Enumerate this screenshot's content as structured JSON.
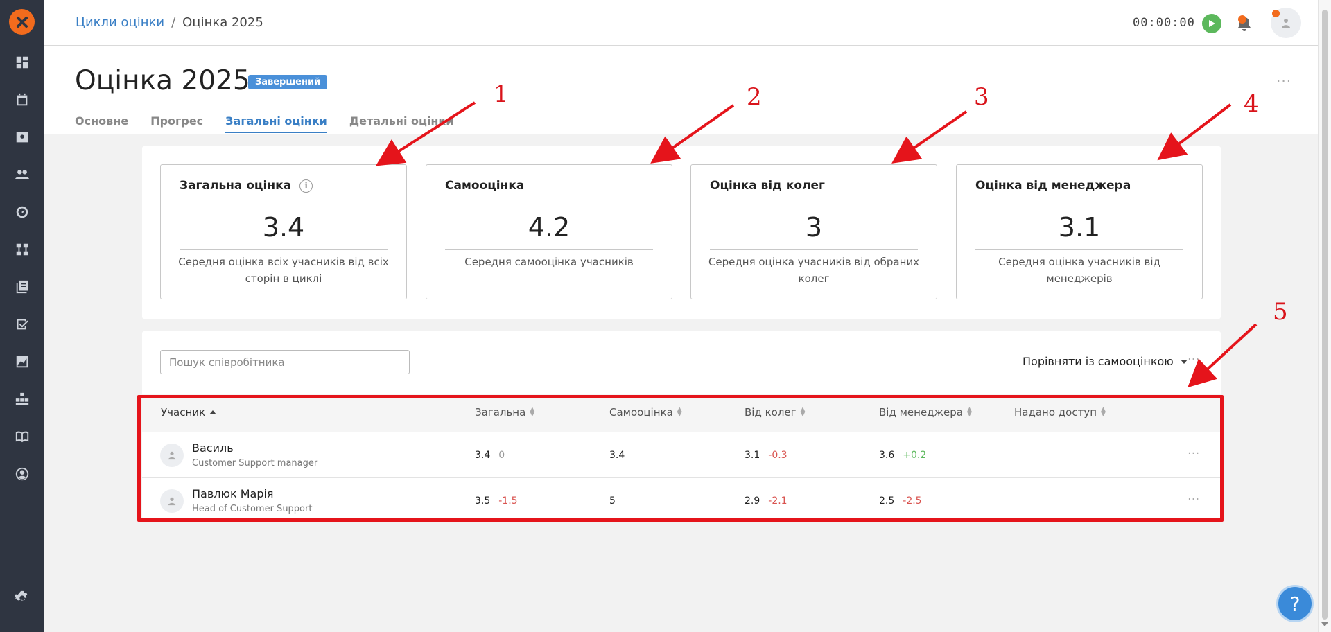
{
  "sidebar": {
    "logo": "x-logo-icon",
    "items": [
      "dashboard-icon",
      "calendar-icon",
      "contact-card-icon",
      "people-icon",
      "gauge-icon",
      "hierarchy-icon",
      "library-icon",
      "checklist-icon",
      "chart-icon",
      "org-blocks-icon",
      "book-icon",
      "user-circle-icon"
    ],
    "settings": "gear-icon"
  },
  "topbar": {
    "breadcrumb_link": "Цикли оцінки",
    "breadcrumb_sep": "/",
    "breadcrumb_current": "Оцінка 2025",
    "timer": "00:00:00"
  },
  "header": {
    "title": "Оцінка 2025",
    "status": "Завершений",
    "more": "···",
    "tabs": [
      {
        "label": "Основне"
      },
      {
        "label": "Прогрес"
      },
      {
        "label": "Загальні оцінки"
      },
      {
        "label": "Детальні оцінки"
      }
    ]
  },
  "summary": {
    "cards": [
      {
        "title": "Загальна оцінка",
        "info": "i",
        "value": "3.4",
        "desc": "Середня оцінка всіх учасників від всіх сторін в циклі"
      },
      {
        "title": "Самооцінка",
        "value": "4.2",
        "desc": "Середня самооцінка учасників"
      },
      {
        "title": "Оцінка від колег",
        "value": "3",
        "desc": "Середня оцінка учасників від обраних колег"
      },
      {
        "title": "Оцінка від менеджера",
        "value": "3.1",
        "desc": "Середня оцінка учасників від менеджерів"
      }
    ]
  },
  "table": {
    "search_placeholder": "Пошук співробітника",
    "compare_label": "Порівняти із самооцінкою",
    "more": "···",
    "columns": [
      "Учасник",
      "Загальна",
      "Самооцінка",
      "Від колег",
      "Від менеджера",
      "Надано доступ"
    ],
    "rows": [
      {
        "name": "Василь",
        "role": "Customer Support manager",
        "overall": "3.4",
        "overall_delta": "0",
        "self": "3.4",
        "peers": "3.1",
        "peers_delta": "-0.3",
        "manager": "3.6",
        "manager_delta": "+0.2",
        "more": "···"
      },
      {
        "name": "Павлюк Марія",
        "role": "Head of Customer Support",
        "overall": "3.5",
        "overall_delta": "-1.5",
        "self": "5",
        "peers": "2.9",
        "peers_delta": "-2.1",
        "manager": "2.5",
        "manager_delta": "-2.5",
        "more": "···"
      }
    ]
  },
  "annotations": [
    "1",
    "2",
    "3",
    "4",
    "5"
  ],
  "help": "?",
  "colors": {
    "accent": "#3a7fc5",
    "brand": "#f26b1d",
    "sidebar": "#2f3541",
    "annotation": "#e5141b",
    "negative": "#d9534f",
    "positive": "#5cb85c"
  }
}
